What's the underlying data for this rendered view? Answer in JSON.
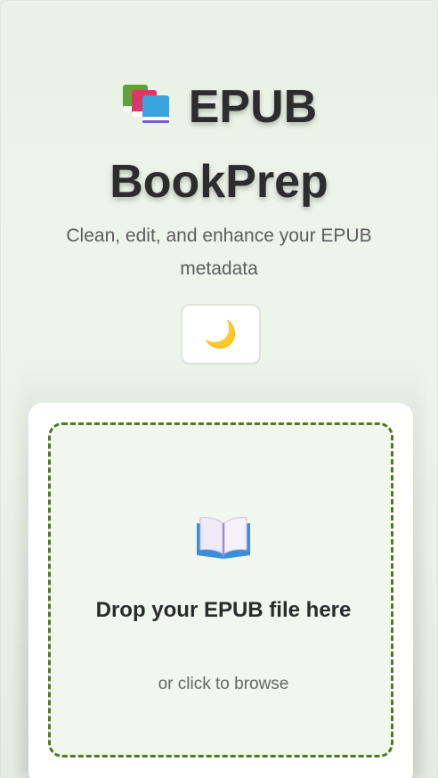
{
  "header": {
    "title": "EPUB BookPrep",
    "subtitle": "Clean, edit, and enhance your EPUB metadata",
    "logo_icon": "books-icon"
  },
  "theme_toggle": {
    "icon": "crescent-moon-icon",
    "glyph": "🌙"
  },
  "upload": {
    "icon": "open-book-icon",
    "title": "Drop your EPUB file here",
    "subtitle": "or click to browse"
  },
  "colors": {
    "accent": "#4f7a1f",
    "background": "#eaf2e6",
    "card": "#ffffff",
    "title_text": "#2d2d2d"
  }
}
